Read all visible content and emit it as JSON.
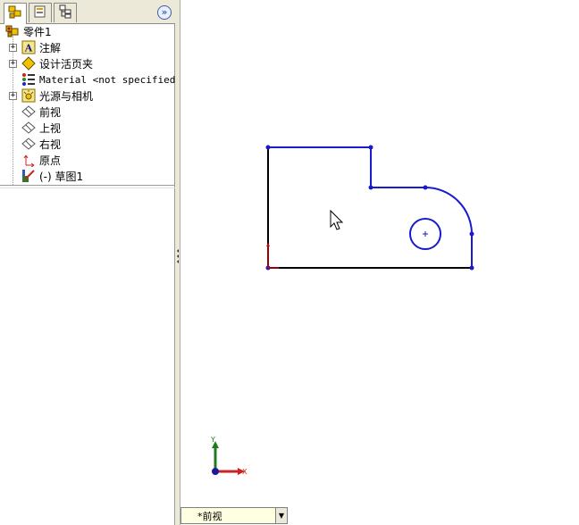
{
  "feature_manager": {
    "tabs": [
      {
        "icon": "feature-tree-icon"
      },
      {
        "icon": "property-manager-icon"
      },
      {
        "icon": "configuration-manager-icon"
      }
    ],
    "expand_icon": "double-chevron-right-icon",
    "expand_glyph": "»",
    "root": {
      "label": "零件1",
      "icon": "part-icon"
    },
    "items": [
      {
        "label": "注解",
        "icon": "annotations-icon",
        "expandable": true
      },
      {
        "label": "设计活页夹",
        "icon": "design-binder-icon",
        "expandable": true
      },
      {
        "label": "Material <not specified>",
        "icon": "material-icon",
        "expandable": false,
        "mono": true
      },
      {
        "label": "光源与相机",
        "icon": "lights-cameras-icon",
        "expandable": true
      },
      {
        "label": "前视",
        "icon": "plane-icon",
        "expandable": false
      },
      {
        "label": "上视",
        "icon": "plane-icon",
        "expandable": false
      },
      {
        "label": "右视",
        "icon": "plane-icon",
        "expandable": false
      },
      {
        "label": "原点",
        "icon": "origin-icon",
        "expandable": false
      },
      {
        "label": "(-) 草图1",
        "icon": "sketch-icon",
        "expandable": false
      }
    ]
  },
  "viewport": {
    "sketch_color": "#1a1acc",
    "origin_color": "#cc0000",
    "triad": {
      "x_label": "X",
      "y_label": "Y",
      "x_color": "#cc2222",
      "y_color": "#1f7a1f",
      "z_color": "#1a1a9a"
    }
  },
  "statusbar": {
    "view_name": "*前视",
    "arrow_glyph": "▼"
  }
}
